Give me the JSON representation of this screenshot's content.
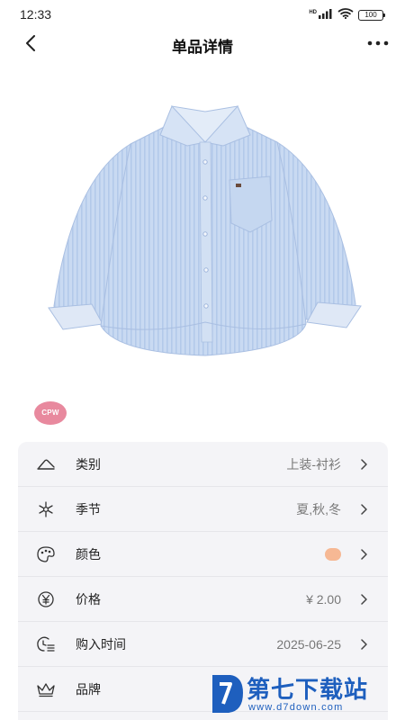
{
  "status_bar": {
    "time": "12:33",
    "network_label": "HD",
    "battery_level": "100"
  },
  "nav": {
    "title": "单品详情"
  },
  "brand_badge": "CPW",
  "details": [
    {
      "icon": "clothes-hanger-icon",
      "label": "类别",
      "value": "上装-衬衫"
    },
    {
      "icon": "snowflake-sun-icon",
      "label": "季节",
      "value": "夏,秋,冬"
    },
    {
      "icon": "palette-icon",
      "label": "颜色",
      "value": "",
      "swatch": "#f6b894"
    },
    {
      "icon": "yen-icon",
      "label": "价格",
      "value": "¥ 2.00"
    },
    {
      "icon": "clock-list-icon",
      "label": "购入时间",
      "value": "2025-06-25"
    },
    {
      "icon": "crown-icon",
      "label": "品牌",
      "value": ""
    }
  ],
  "watermark": {
    "title": "第七下载站",
    "url": "www.d7down.com"
  }
}
